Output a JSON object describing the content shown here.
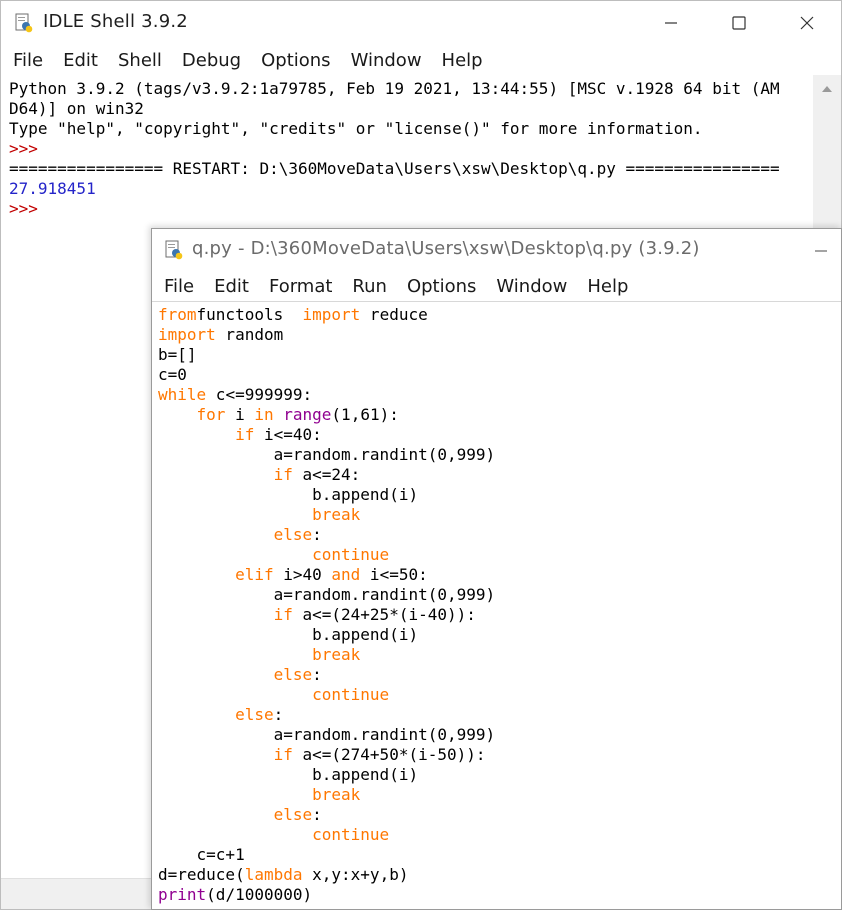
{
  "shell": {
    "title": "IDLE Shell 3.9.2",
    "menu": [
      "File",
      "Edit",
      "Shell",
      "Debug",
      "Options",
      "Window",
      "Help"
    ],
    "banner_1": "Python 3.9.2 (tags/v3.9.2:1a79785, Feb 19 2021, 13:44:55) [MSC v.1928 64 bit (AM",
    "banner_2": "D64)] on win32",
    "banner_3": "Type \"help\", \"copyright\", \"credits\" or \"license()\" for more information.",
    "prompt": ">>>",
    "restart": "================ RESTART: D:\\360MoveData\\Users\\xsw\\Desktop\\q.py ================",
    "output": "27.918451"
  },
  "editor": {
    "title": "q.py - D:\\360MoveData\\Users\\xsw\\Desktop\\q.py (3.9.2)",
    "menu": [
      "File",
      "Edit",
      "Format",
      "Run",
      "Options",
      "Window",
      "Help"
    ],
    "code": [
      [
        [
          "kw",
          "from"
        ],
        [
          "",
          "functools "
        ],
        [
          "kw",
          " import"
        ],
        [
          "",
          " reduce"
        ]
      ],
      [
        [
          "kw",
          "import"
        ],
        [
          "",
          " random"
        ]
      ],
      [
        [
          "",
          "b=[]"
        ]
      ],
      [
        [
          "",
          "c=0"
        ]
      ],
      [
        [
          "kw",
          "while"
        ],
        [
          "",
          " c<=999999:"
        ]
      ],
      [
        [
          "",
          "    "
        ],
        [
          "kw",
          "for"
        ],
        [
          "",
          " i "
        ],
        [
          "kw",
          "in"
        ],
        [
          "",
          " "
        ],
        [
          "bi",
          "range"
        ],
        [
          "",
          "(1,61):"
        ]
      ],
      [
        [
          "",
          "        "
        ],
        [
          "kw",
          "if"
        ],
        [
          "",
          " i<=40:"
        ]
      ],
      [
        [
          "",
          "            a=random.randint(0,999)"
        ]
      ],
      [
        [
          "",
          "            "
        ],
        [
          "kw",
          "if"
        ],
        [
          "",
          " a<=24:"
        ]
      ],
      [
        [
          "",
          "                b.append(i)"
        ]
      ],
      [
        [
          "",
          "                "
        ],
        [
          "kw",
          "break"
        ]
      ],
      [
        [
          "",
          "            "
        ],
        [
          "kw",
          "else"
        ],
        [
          "",
          ":"
        ]
      ],
      [
        [
          "",
          "                "
        ],
        [
          "kw",
          "continue"
        ]
      ],
      [
        [
          "",
          "        "
        ],
        [
          "kw",
          "elif"
        ],
        [
          "",
          " i>40 "
        ],
        [
          "kw",
          "and"
        ],
        [
          "",
          " i<=50:"
        ]
      ],
      [
        [
          "",
          "            a=random.randint(0,999)"
        ]
      ],
      [
        [
          "",
          "            "
        ],
        [
          "kw",
          "if"
        ],
        [
          "",
          " a<=(24+25*(i-40)):"
        ]
      ],
      [
        [
          "",
          "                b.append(i)"
        ]
      ],
      [
        [
          "",
          "                "
        ],
        [
          "kw",
          "break"
        ]
      ],
      [
        [
          "",
          "            "
        ],
        [
          "kw",
          "else"
        ],
        [
          "",
          ":"
        ]
      ],
      [
        [
          "",
          "                "
        ],
        [
          "kw",
          "continue"
        ]
      ],
      [
        [
          "",
          "        "
        ],
        [
          "kw",
          "else"
        ],
        [
          "",
          ":"
        ]
      ],
      [
        [
          "",
          "            a=random.randint(0,999)"
        ]
      ],
      [
        [
          "",
          "            "
        ],
        [
          "kw",
          "if"
        ],
        [
          "",
          " a<=(274+50*(i-50)):"
        ]
      ],
      [
        [
          "",
          "                b.append(i)"
        ]
      ],
      [
        [
          "",
          "                "
        ],
        [
          "kw",
          "break"
        ]
      ],
      [
        [
          "",
          "            "
        ],
        [
          "kw",
          "else"
        ],
        [
          "",
          ":"
        ]
      ],
      [
        [
          "",
          "                "
        ],
        [
          "kw",
          "continue"
        ]
      ],
      [
        [
          "",
          "    c=c+1"
        ]
      ],
      [
        [
          "",
          "d=reduce("
        ],
        [
          "kw",
          "lambda"
        ],
        [
          "",
          " x,y:x+y,b)"
        ]
      ],
      [
        [
          "bi",
          "print"
        ],
        [
          "",
          "(d/1000000)"
        ]
      ]
    ]
  }
}
